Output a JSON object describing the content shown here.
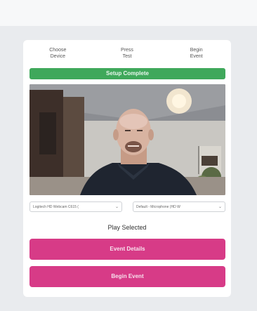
{
  "steps": [
    {
      "line1": "Choose",
      "line2": "Device"
    },
    {
      "line1": "Press",
      "line2": "Test"
    },
    {
      "line1": "Begin",
      "line2": "Event"
    }
  ],
  "status": "Setup Complete",
  "devices": {
    "camera": "Logitech HD Webcam C615 (",
    "microphone": "Default - Microphone (HD W"
  },
  "play_label": "Play Selected",
  "buttons": {
    "details": "Event Details",
    "begin": "Begin Event"
  },
  "colors": {
    "status_green": "#3fa85b",
    "accent_pink": "#d73b87"
  }
}
